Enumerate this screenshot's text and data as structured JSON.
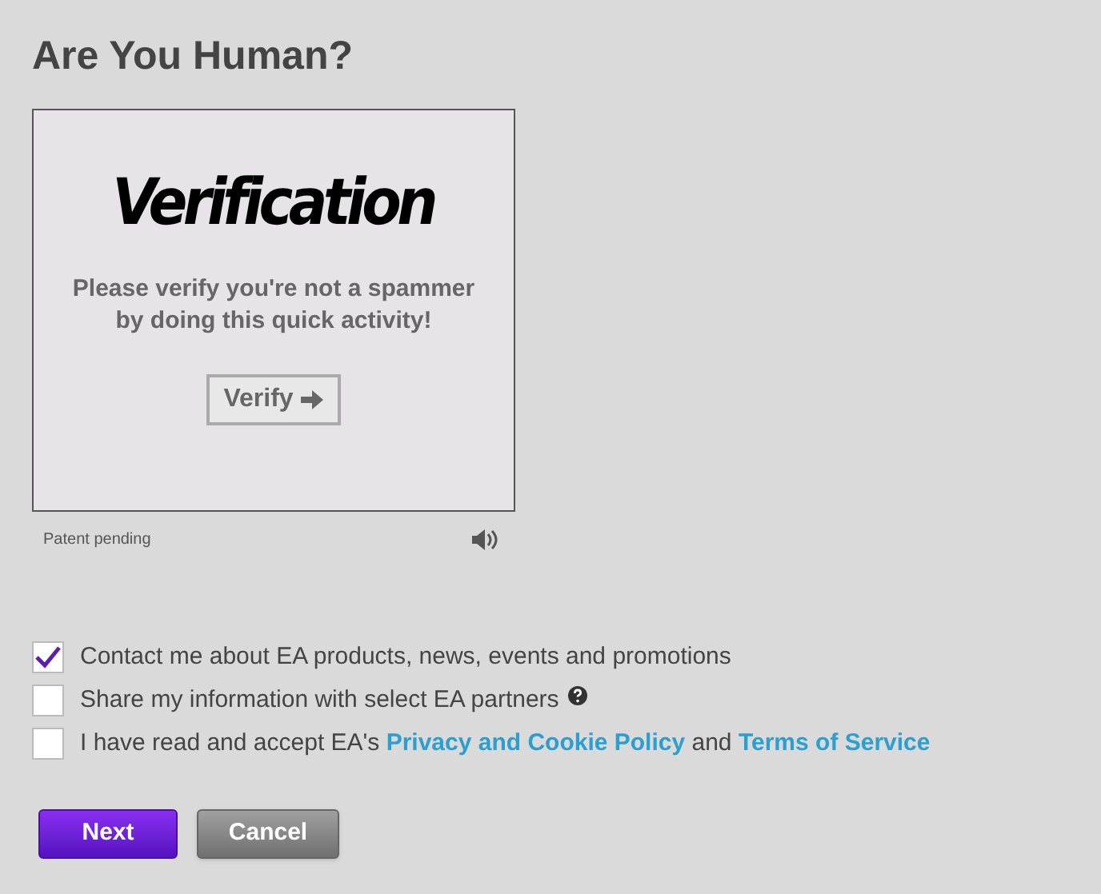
{
  "title": "Are You Human?",
  "captcha": {
    "logo": "Verification",
    "message": "Please verify you're not a spammer by doing this quick activity!",
    "button": "Verify",
    "footnote": "Patent pending"
  },
  "options": [
    {
      "checked": true,
      "help": false,
      "parts": [
        {
          "kind": "text",
          "text": "Contact me about EA products, news, events and promotions"
        }
      ]
    },
    {
      "checked": false,
      "help": true,
      "parts": [
        {
          "kind": "text",
          "text": "Share my information with select EA partners"
        }
      ]
    },
    {
      "checked": false,
      "help": false,
      "parts": [
        {
          "kind": "text",
          "text": "I have read and accept EA's "
        },
        {
          "kind": "link",
          "text": "Privacy and Cookie Policy"
        },
        {
          "kind": "text",
          "text": " and "
        },
        {
          "kind": "link",
          "text": "Terms of Service"
        }
      ]
    }
  ],
  "buttons": [
    {
      "kind": "primary",
      "label": "Next"
    },
    {
      "kind": "secondary",
      "label": "Cancel"
    }
  ]
}
